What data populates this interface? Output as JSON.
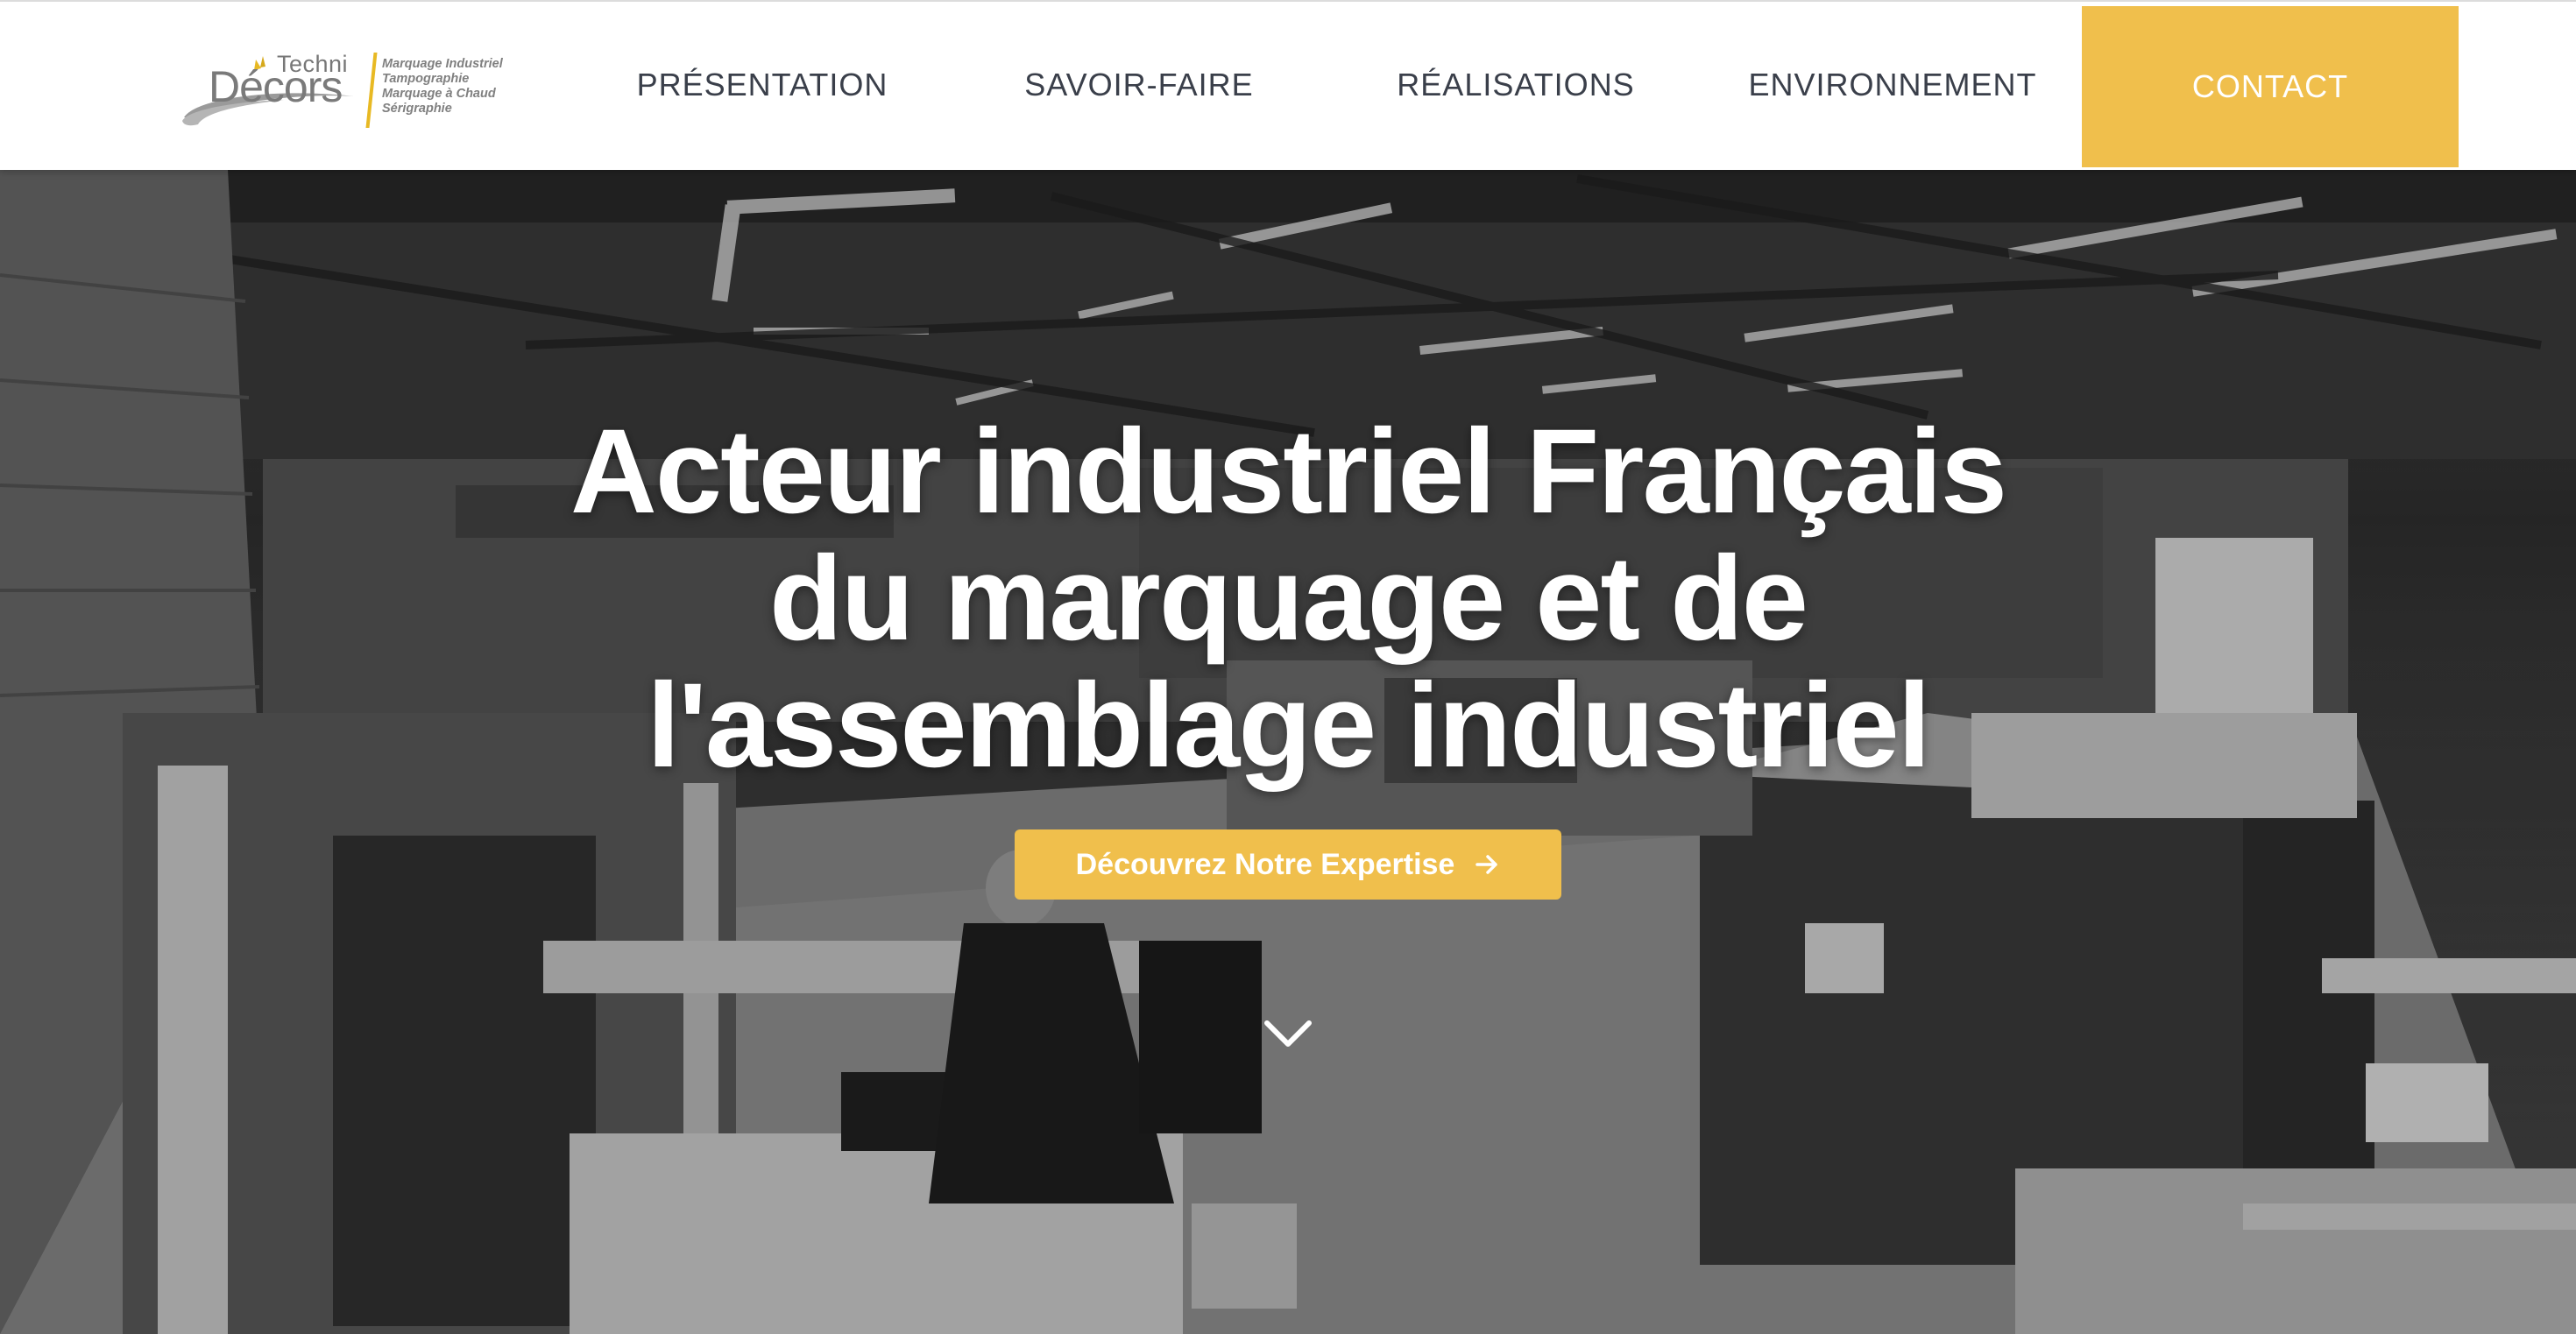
{
  "logo": {
    "brand_top": "Techni",
    "brand_main": "Décors",
    "tagline": [
      "Marquage Industriel",
      "Tampographie",
      "Marquage à Chaud",
      "Sérigraphie"
    ],
    "accent_color": "#e8b923"
  },
  "nav": {
    "items": [
      {
        "label": "PRÉSENTATION"
      },
      {
        "label": "SAVOIR-FAIRE"
      },
      {
        "label": "RÉALISATIONS"
      },
      {
        "label": "ENVIRONNEMENT"
      }
    ],
    "contact_label": "CONTACT",
    "contact_color": "#f0bf4c"
  },
  "hero": {
    "title_lines": [
      "Acteur industriel Français",
      "du marquage et de",
      "l'assemblage industriel"
    ],
    "cta_label": "Découvrez Notre Expertise",
    "cta_icon": "arrow-right-icon",
    "scroll_icon": "chevron-down-icon",
    "background": "grayscale photo of industrial workshop"
  }
}
